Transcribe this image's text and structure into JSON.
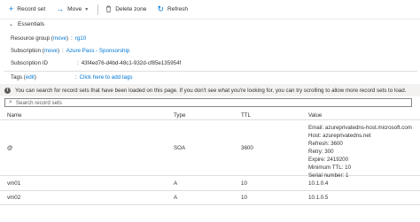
{
  "toolbar": {
    "record_set_label": "Record set",
    "move_label": "Move",
    "delete_zone_label": "Delete zone",
    "refresh_label": "Refresh"
  },
  "essentials": {
    "title": "Essentials",
    "resource_group_key": "Resource group",
    "resource_group_move": "move",
    "resource_group_value": "rg10",
    "subscription_key": "Subscription",
    "subscription_move": "move",
    "subscription_value": "Azure Pass - Sponsorship",
    "subscription_id_key": "Subscription ID",
    "subscription_id_value": "43f4ed76-d4bd-48c1-932d-cf85e135954f",
    "tags_key": "Tags",
    "tags_edit": "edit",
    "tags_value": "Click here to add tags"
  },
  "info_bar": {
    "text": "You can search for record sets that have been loaded on this page. If you don't see what you're looking for, you can try scrolling to allow more record sets to load."
  },
  "search": {
    "placeholder": "Search record sets"
  },
  "table": {
    "headers": {
      "name": "Name",
      "type": "Type",
      "ttl": "TTL",
      "value": "Value"
    },
    "rows": [
      {
        "name": "@",
        "type": "SOA",
        "ttl": "3600",
        "value_lines": [
          "Email: azureprivatedns-host.microsoft.com",
          "Host: azureprivatedns.net",
          "Refresh: 3600",
          "Retry: 300",
          "Expire: 2419200",
          "Minimum TTL: 10",
          "Serial number: 1"
        ]
      },
      {
        "name": "vm01",
        "type": "A",
        "ttl": "10",
        "value_lines": [
          "10.1.0.4"
        ]
      },
      {
        "name": "vm02",
        "type": "A",
        "ttl": "10",
        "value_lines": [
          "10.1.0.5"
        ]
      }
    ]
  },
  "colors": {
    "accent": "#0078d4",
    "text": "#323130",
    "info_bg": "#f3f2f1"
  }
}
